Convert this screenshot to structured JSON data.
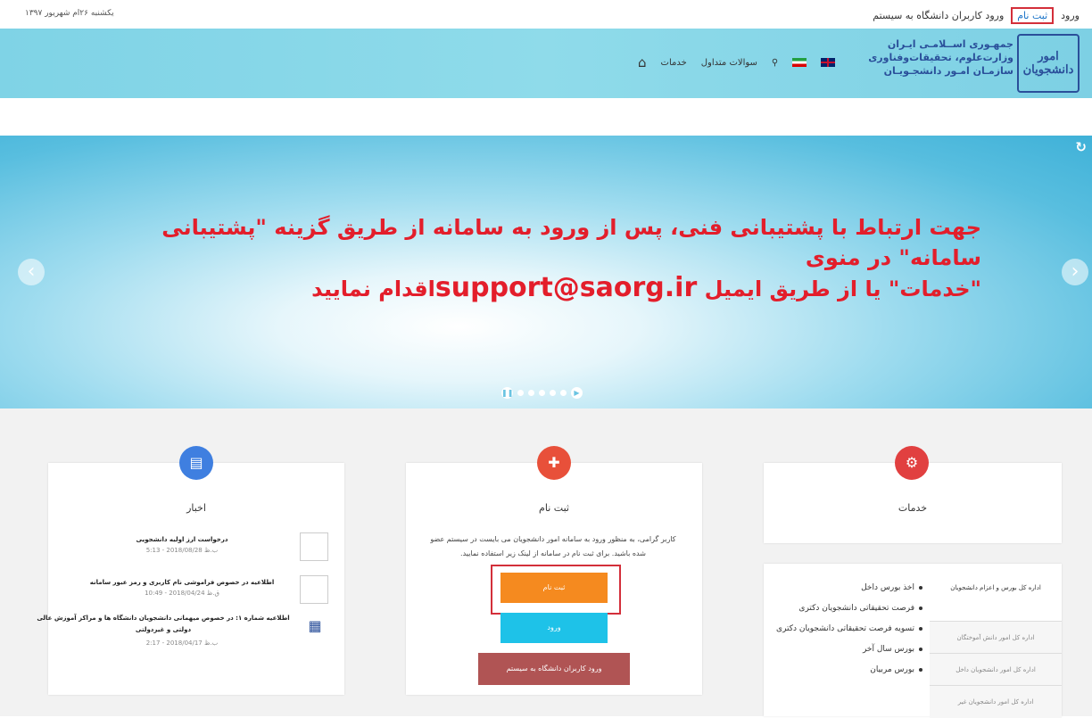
{
  "topbar": {
    "date": "یکشنبه ۲۶ام شهریور ۱۳۹۷",
    "login_link": "ورود",
    "register_link": "ثبت نام",
    "university_login_link": "ورود کاربران دانشگاه به سیستم"
  },
  "header": {
    "logo_text": "امور دانشجویان",
    "org_line1": "جمهـوری اســلامـی ایـران",
    "org_line2": "وزارت‌علوم، تحقیقات‌وفناوری",
    "org_line3": "سازمـان امـور دانشجـویـان",
    "nav": {
      "services": "خدمات",
      "faq": "سوالات متداول"
    }
  },
  "slider": {
    "line1": "جهت ارتباط با پشتیبانی فنی، پس از ورود به سامانه از طریق گزینه \"پشتیبانی سامانه\" در منوی",
    "line2_prefix": "\"خدمات\" یا از طریق ایمیل ",
    "email": "support@saorg.ir",
    "line2_suffix": "اقدام نمایید"
  },
  "news": {
    "title": "اخبار",
    "items": [
      {
        "title": "درخواست ارز اولیه دانشجویی",
        "date": "5:13 - 2018/08/28 ب.ظ"
      },
      {
        "title": "اطلاعیه در خصوص فراموشی نام کاربری و رمز عبور سامانه",
        "date": "10:49 - 2018/04/24 ق.ظ"
      },
      {
        "title": "اطلاعیه شماره ۱: در خصوص میهمانی دانشجویان دانشگاه ها و مراکز آموزش عالی دولتی و غیردولتی",
        "date": "2:17 - 2018/04/17 ب.ظ"
      }
    ]
  },
  "register": {
    "title": "ثبت نام",
    "description": "کاربر گرامی، به منظور ورود به سامانه امور دانشجویان می بایست در سیستم عضو شده باشید. برای ثبت نام در سامانه از لینک زیر استفاده نمایید.",
    "register_button": "ثبت نام",
    "login_button": "ورود",
    "university_button": "ورود کاربران دانشگاه به سیستم"
  },
  "services": {
    "title": "خدمات",
    "tabs": [
      "اداره کل بورس و اعزام دانشجویان",
      "اداره کل امور دانش آموختگان",
      "اداره کل امور دانشجویان داخل",
      "اداره کل امور دانشجویان غیر"
    ],
    "items": [
      "اخذ بورس داخل",
      "فرصت تحقیقاتی دانشجویان دکتری",
      "تسویه فرصت تحقیقاتی دانشجویان دکتری",
      "بورس سال آخر",
      "بورس مربیان"
    ]
  },
  "colors": {
    "header_bg": "#8fdbea",
    "alert_text": "#e31e2b",
    "news_circle": "#3f7fe0",
    "register_circle": "#e8503a",
    "services_circle": "#e14040",
    "register_button": "#f58a1f",
    "login_button": "#1ec2e8",
    "university_button": "#b05454",
    "highlight_border": "#d32f3a"
  }
}
